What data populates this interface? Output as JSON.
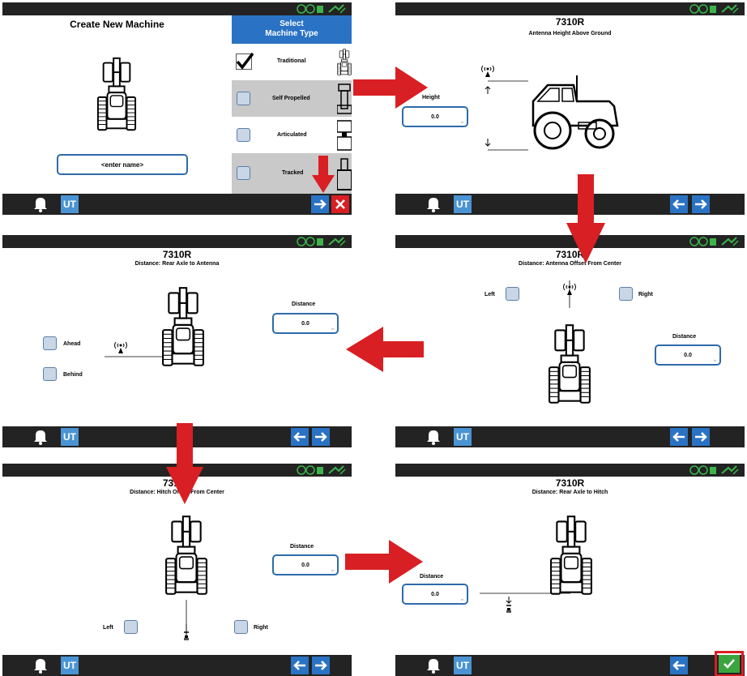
{
  "panel1": {
    "title": "Create New Machine",
    "name_placeholder": "<enter name>",
    "select_header_line1": "Select",
    "select_header_line2": "Machine Type",
    "types": [
      {
        "label": "Traditional",
        "checked": true
      },
      {
        "label": "Self Propelled",
        "checked": false
      },
      {
        "label": "Articulated",
        "checked": false
      },
      {
        "label": "Tracked",
        "checked": false
      }
    ]
  },
  "panel2": {
    "title": "7310R",
    "subtitle": "Antenna Height Above Ground",
    "field_label": "Height",
    "field_value": "0.0"
  },
  "panel3": {
    "title": "7310R",
    "subtitle": "Distance: Rear Axle to Antenna",
    "field_label": "Distance",
    "field_value": "0.0",
    "option_ahead": "Ahead",
    "option_behind": "Behind"
  },
  "panel4": {
    "title": "7310R",
    "subtitle": "Distance: Antenna Offset From Center",
    "field_label": "Distance",
    "field_value": "0.0",
    "option_left": "Left",
    "option_right": "Right"
  },
  "panel5": {
    "title": "7310R",
    "subtitle": "Distance: Hitch Offset From Center",
    "field_label": "Distance",
    "field_value": "0.0",
    "option_left": "Left",
    "option_right": "Right"
  },
  "panel6": {
    "title": "7310R",
    "subtitle": "Distance: Rear Axle to Hitch",
    "field_label": "Distance",
    "field_value": "0.0"
  },
  "icons": {
    "alarm": "bell-icon",
    "ut": "UT",
    "back": "arrow-left-icon",
    "next": "arrow-right-icon",
    "cancel": "close-icon",
    "confirm": "checkmark-icon"
  },
  "colors": {
    "topbar": "#232323",
    "nav_button": "#2a73c4",
    "select_header": "#2a73c4",
    "cancel": "#d81f24",
    "confirm": "#3aa53f",
    "annotation_arrow": "#d81f24",
    "status_green": "#3bb54a"
  }
}
